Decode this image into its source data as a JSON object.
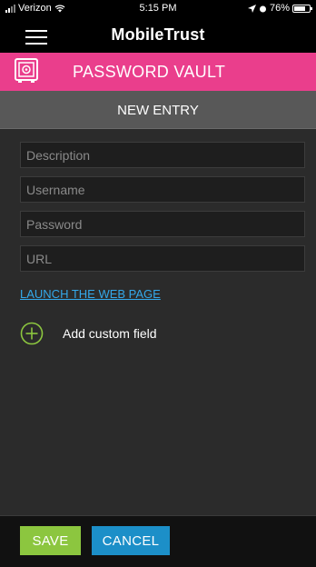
{
  "status_bar": {
    "carrier": "Verizon",
    "time": "5:15 PM",
    "battery": "76%",
    "battery_level": 0.76
  },
  "app_bar": {
    "brand": "MobileTrust",
    "menu_icon": "hamburger-menu-icon"
  },
  "section": {
    "title": "PASSWORD VAULT",
    "icon": "vault-safe-icon",
    "color": "#ea3e8c"
  },
  "subheader": {
    "title": "NEW ENTRY"
  },
  "form": {
    "description": {
      "placeholder": "Description",
      "value": ""
    },
    "username": {
      "placeholder": "Username",
      "value": ""
    },
    "password": {
      "placeholder": "Password",
      "value": ""
    },
    "url": {
      "placeholder": "URL",
      "value": ""
    }
  },
  "launch_link": "LAUNCH THE WEB PAGE",
  "add_custom_field": {
    "label": "Add custom field",
    "icon": "plus-circle-icon",
    "color": "#8cc63f"
  },
  "footer": {
    "save_label": "SAVE",
    "cancel_label": "CANCEL",
    "save_color": "#8cc63f",
    "cancel_color": "#1c8fc8"
  }
}
